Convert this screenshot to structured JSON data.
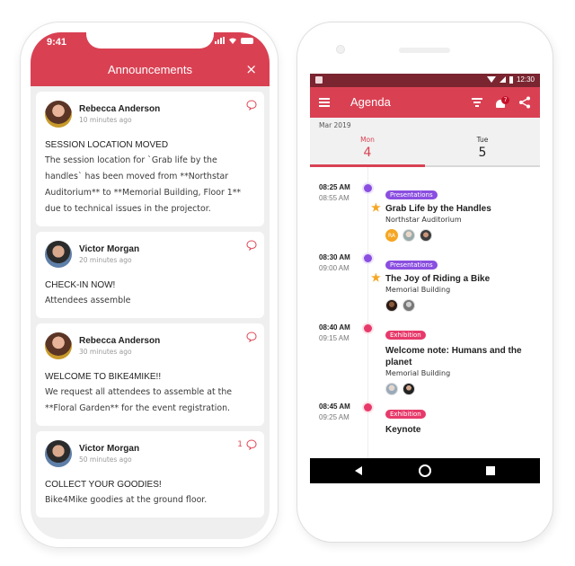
{
  "ios": {
    "status_time": "9:41",
    "header_title": "Announcements",
    "close_icon": "×",
    "announcements": [
      {
        "author": "Rebecca Anderson",
        "time": "10 minutes ago",
        "title": "SESSION LOCATION MOVED",
        "body": "The session location for `Grab life by the handles` has been moved from **Northstar Auditorium** to **Memorial Building, Floor 1** due to technical issues in the projector.",
        "comment_count": ""
      },
      {
        "author": "Victor Morgan",
        "time": "20 minutes ago",
        "title": "CHECK-IN NOW!",
        "body": "Attendees assemble",
        "comment_count": ""
      },
      {
        "author": "Rebecca Anderson",
        "time": "30 minutes ago",
        "title": "WELCOME TO BIKE4MIKE!!",
        "body": "We request all attendees to assemble at the **Floral Garden** for the event registration.",
        "comment_count": ""
      },
      {
        "author": "Victor Morgan",
        "time": "50 minutes ago",
        "title": "COLLECT YOUR GOODIES!",
        "body": "Bike4Mike goodies at the ground floor.",
        "comment_count": "1"
      }
    ]
  },
  "android": {
    "status_time": "12:30",
    "toolbar_title": "Agenda",
    "notification_badge": "7",
    "month_label": "Mar 2019",
    "days": [
      {
        "name": "Mon",
        "number": "4",
        "active": true
      },
      {
        "name": "Tue",
        "number": "5",
        "active": false
      }
    ],
    "sessions": [
      {
        "start": "08:25 AM",
        "end": "08:55 AM",
        "tag": "Presentations",
        "title": "Grab Life by the Handles",
        "location": "Northstar Auditorium",
        "starred": true,
        "speakers": [
          "RA",
          "",
          ""
        ]
      },
      {
        "start": "08:30 AM",
        "end": "09:00 AM",
        "tag": "Presentations",
        "title": "The Joy of Riding a Bike",
        "location": "Memorial Building",
        "starred": true,
        "speakers": [
          "",
          ""
        ]
      },
      {
        "start": "08:40 AM",
        "end": "09:15 AM",
        "tag": "Exhibition",
        "title": "Welcome note: Humans and the planet",
        "location": "Memorial Building",
        "starred": false,
        "speakers": [
          "",
          ""
        ]
      },
      {
        "start": "08:45 AM",
        "end": "09:25 AM",
        "tag": "Exhibition",
        "title": "Keynote",
        "location": "",
        "starred": false,
        "speakers": []
      }
    ]
  },
  "colors": {
    "brand": "#d94153",
    "status_bar_dark": "#7a2530",
    "presentations": "#8a4ee0",
    "exhibition": "#e73a6a",
    "star": "#f5a623"
  }
}
